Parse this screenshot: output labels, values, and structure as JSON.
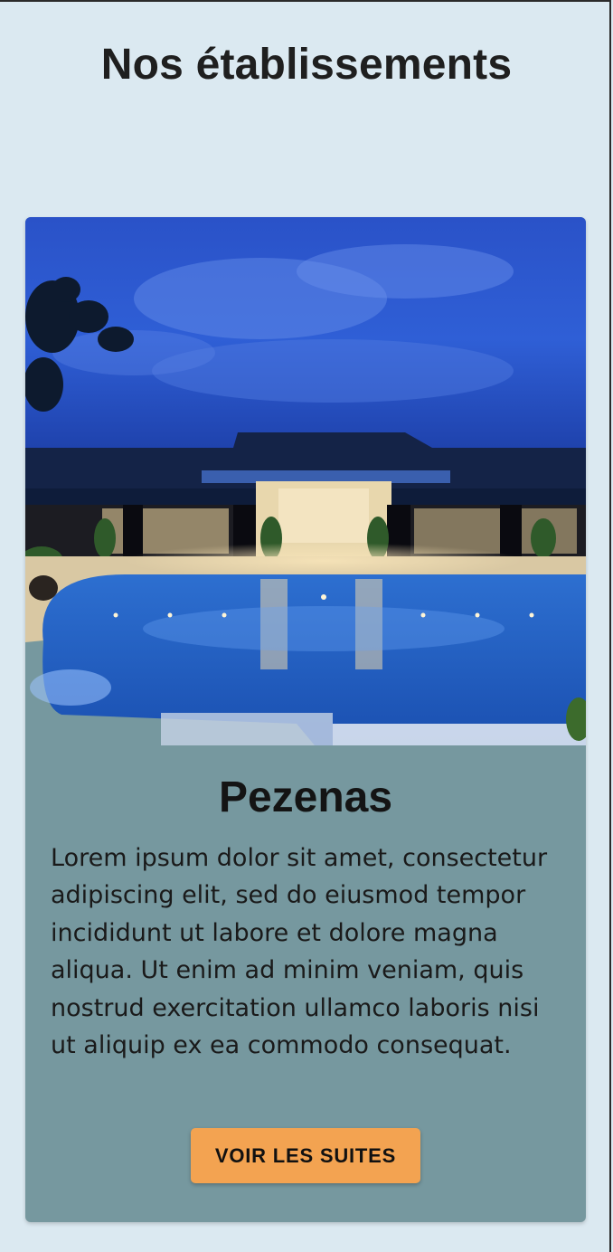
{
  "page": {
    "title": "Nos établissements"
  },
  "establishment": {
    "image_description": "hotel-pool-at-dusk",
    "name": "Pezenas",
    "description": "Lorem ipsum dolor sit amet, consectetur adipiscing elit, sed do eiusmod tempor incididunt ut labore et dolore magna aliqua. Ut enim ad minim veniam, quis nostrud exercitation ullamco laboris nisi ut aliquip ex ea commodo consequat.",
    "button_label": "VOIR LES SUITES"
  },
  "colors": {
    "page_background": "#dbe9f1",
    "card_background": "#76989f",
    "button_background": "#f3a351",
    "title_text": "#1f1f1f"
  }
}
